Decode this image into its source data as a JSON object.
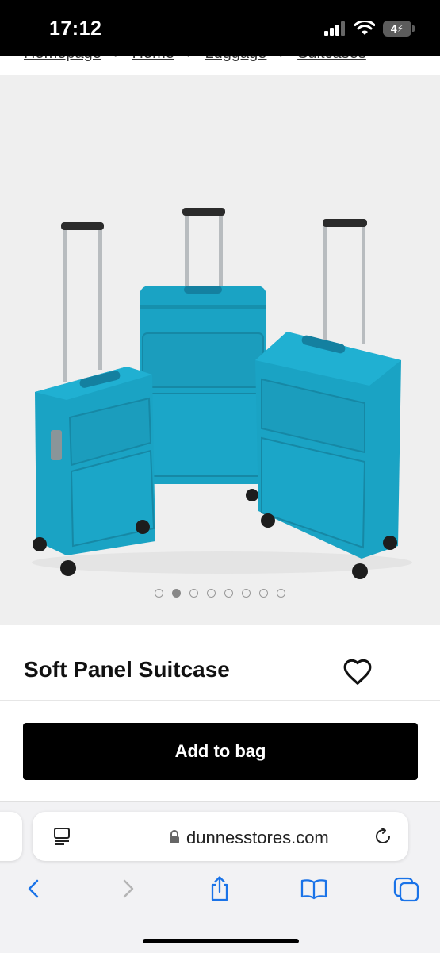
{
  "status_bar": {
    "time": "17:12",
    "battery": "4"
  },
  "breadcrumb": {
    "items": [
      "Homepage",
      "Home",
      "Luggage",
      "Suitcases"
    ],
    "separator": "›"
  },
  "product": {
    "image_alt": "Three teal suitcases",
    "image_count": 8,
    "active_image": 1,
    "title": "Soft Panel Suitcase",
    "add_to_bag_label": "Add to bag"
  },
  "browser": {
    "url": "dunnesstores.com"
  },
  "colors": {
    "suitcase": "#1a9fbf",
    "button_bg": "#000000",
    "ios_blue": "#1a73e8"
  },
  "icons": [
    "signal-icon",
    "wifi-icon",
    "heart-icon",
    "reader-icon",
    "lock-icon",
    "reload-icon",
    "back-icon",
    "forward-icon",
    "share-icon",
    "bookmarks-icon",
    "tabs-icon"
  ]
}
